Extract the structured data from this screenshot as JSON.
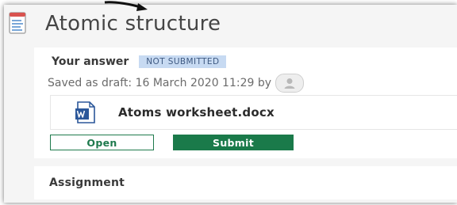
{
  "page": {
    "title": "Atomic structure",
    "title_icon": "document-icon"
  },
  "answer": {
    "label": "Your answer",
    "status_badge": "NOT SUBMITTED",
    "saved_text": "Saved as draft: 16 March 2020 11:29 by",
    "avatar_icon": "user-avatar-icon"
  },
  "file": {
    "icon": "word-document-icon",
    "name": "Atoms worksheet.docx"
  },
  "actions": {
    "open_label": "Open",
    "submit_label": "Submit"
  },
  "assignment": {
    "label": "Assignment"
  },
  "colors": {
    "primary_green": "#1a7a4a",
    "badge_bg": "#c7daf2",
    "badge_text": "#3f5a82",
    "word_blue": "#2b579a"
  }
}
